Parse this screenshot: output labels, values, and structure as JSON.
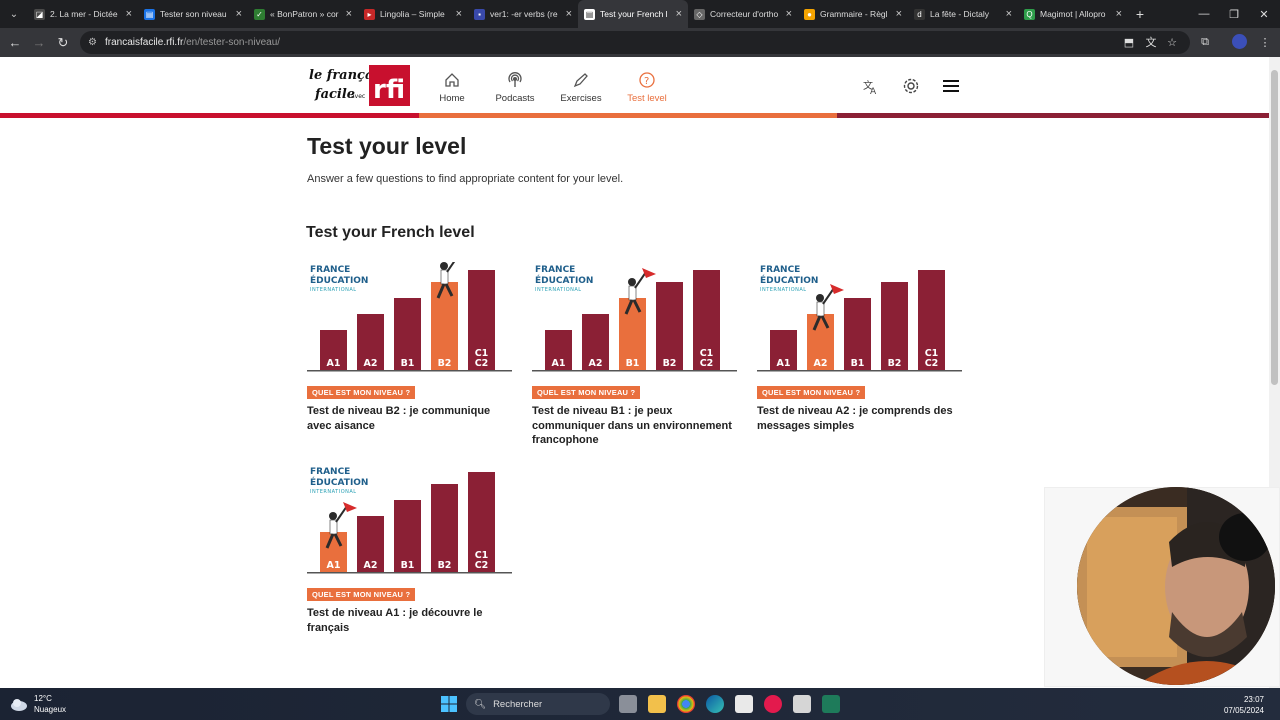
{
  "browser": {
    "tabs": [
      {
        "title": "2. La mer - Dictée",
        "color": "#4a4a4a",
        "glyph": "◪"
      },
      {
        "title": "Tester son niveau",
        "color": "#1a73e8",
        "glyph": "▤"
      },
      {
        "title": "« BonPatron » cor",
        "color": "#2e7d32",
        "glyph": "✓"
      },
      {
        "title": "Lingolia – Simple",
        "color": "#c62828",
        "glyph": "▸"
      },
      {
        "title": "ver1: -er verbs (re",
        "color": "#3949ab",
        "glyph": "▪"
      },
      {
        "title": "Test your French l",
        "color": "#ffffff",
        "glyph": "▤"
      },
      {
        "title": "Correcteur d'ortho",
        "color": "#666666",
        "glyph": "◇"
      },
      {
        "title": "Grammaire - Règl",
        "color": "#f4a300",
        "glyph": "●"
      },
      {
        "title": "La fête - Dictaly",
        "color": "#333333",
        "glyph": "d"
      },
      {
        "title": "Magimot | Allopro",
        "color": "#2e9d4a",
        "glyph": "Q"
      }
    ],
    "active_tab": 5,
    "url_domain": "francaisfacile.rfi.fr",
    "url_path": "/en/tester-son-niveau/"
  },
  "site": {
    "logo_text": "le français facile avec rfi",
    "nav": [
      {
        "label": "Home",
        "icon": "home-icon"
      },
      {
        "label": "Podcasts",
        "icon": "podcast-icon"
      },
      {
        "label": "Exercises",
        "icon": "pencil-icon"
      },
      {
        "label": "Test level",
        "icon": "question-icon"
      }
    ],
    "active_nav": 3,
    "accent": "#e96f3d",
    "brand_red": "#c8102e",
    "bar_colors": [
      "#c8102e",
      "#e96f3d",
      "#8b2035"
    ]
  },
  "main": {
    "title": "Test your level",
    "subtitle": "Answer a few questions to find appropriate content for your level.",
    "section_title": "Test your French level",
    "badge_label": "QUEL EST MON NIVEAU ?",
    "cards": [
      {
        "title": "Test de niveau B2 : je communique avec aisance",
        "highlight": "B2"
      },
      {
        "title": "Test de niveau B1 : je peux communiquer dans un environnement francophone",
        "highlight": "B1"
      },
      {
        "title": "Test de niveau A2 : je comprends des messages simples",
        "highlight": "A2"
      },
      {
        "title": "Test de niveau A1 : je découvre le français",
        "highlight": "A1"
      }
    ],
    "image_logo_line1": "FRANCE",
    "image_logo_line2": "ÉDUCATION",
    "image_logo_line3": "INTERNATIONAL",
    "levels": [
      "A1",
      "A2",
      "B1",
      "B2",
      "C1\nC2"
    ]
  },
  "taskbar": {
    "temperature": "12°C",
    "weather": "Nuageux",
    "search_placeholder": "Rechercher",
    "time": "23:07",
    "date": "07/05/2024"
  }
}
